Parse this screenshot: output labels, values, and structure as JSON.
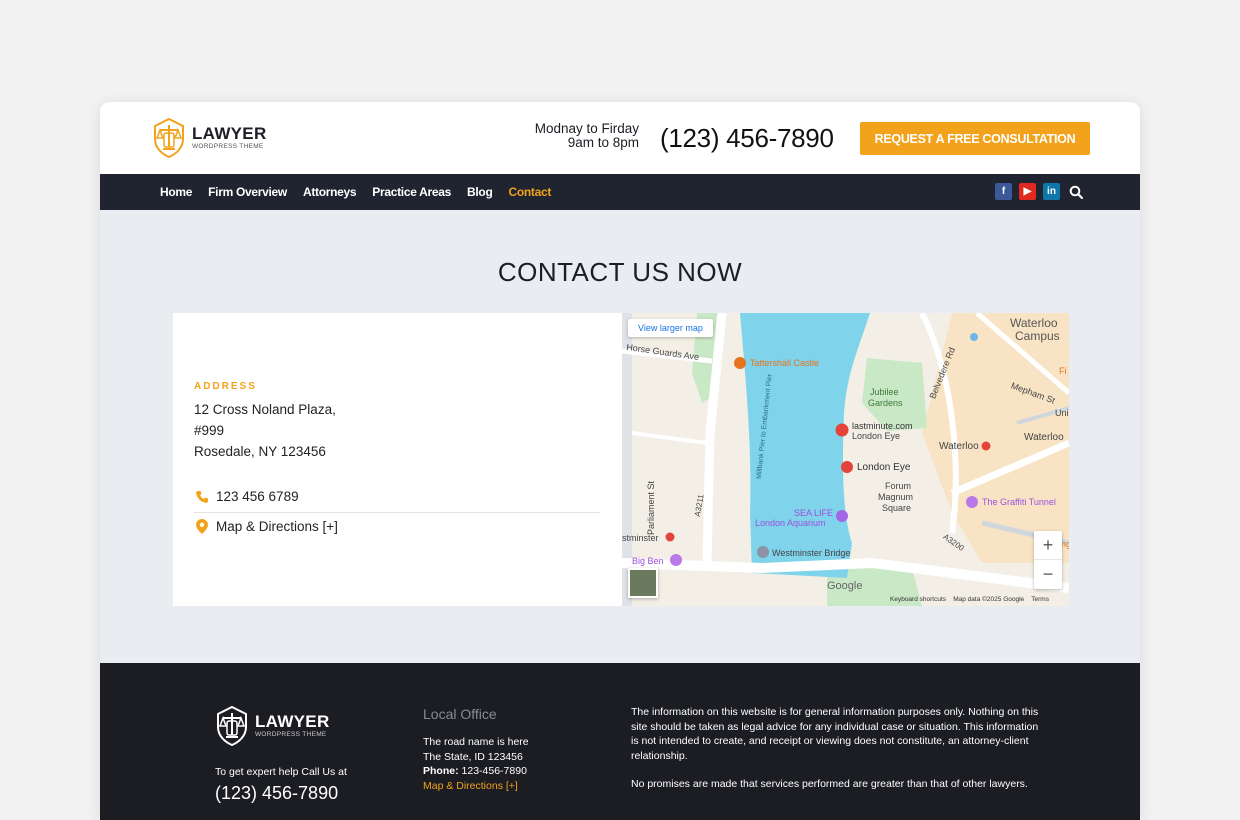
{
  "brand": {
    "name": "LAWYER",
    "tagline": "WORDPRESS THEME"
  },
  "header": {
    "hours_line1": "Modnay to Firday",
    "hours_line2": "9am to 8pm",
    "phone": "(123) 456-7890",
    "cta_label": "REQUEST A FREE CONSULTATION"
  },
  "nav": {
    "items": [
      {
        "label": "Home"
      },
      {
        "label": "Firm Overview"
      },
      {
        "label": "Attorneys"
      },
      {
        "label": "Practice Areas"
      },
      {
        "label": "Blog"
      },
      {
        "label": "Contact"
      }
    ],
    "active": "Contact",
    "social": {
      "facebook": "f",
      "youtube": "▶",
      "linkedin": "in"
    }
  },
  "contact": {
    "title": "CONTACT US NOW",
    "address_label": "ADDRESS",
    "address_line1": "12 Cross Noland Plaza,",
    "address_line2": "#999",
    "address_line3": "Rosedale, NY 123456",
    "phone": "123 456 6789",
    "map_link": "Map & Directions [+]"
  },
  "map": {
    "larger_map": "View larger map",
    "labels": {
      "waterloo_campus_1": "Waterloo",
      "waterloo_campus_2": "Campus",
      "horse_guards": "Horse Guards Ave",
      "tattershall": "Tattershall Castle",
      "jubilee_1": "Jubilee",
      "jubilee_2": "Gardens",
      "belvedere": "Belvedere Rd",
      "mepham": "Mepham St",
      "lastminute_1": "lastminute.com",
      "lastminute_2": "London Eye",
      "waterloo_station": "Waterloo",
      "waterloo_east": "Waterloo",
      "london_eye": "London Eye",
      "forum_1": "Forum",
      "forum_2": "Magnum",
      "forum_3": "Square",
      "graffiti": "The Graffiti Tunnel",
      "parliament": "Parliament St",
      "a3211": "A3211",
      "sea_life_1": "SEA LIFE",
      "sea_life_2": "London Aquarium",
      "westminster": "stminster",
      "westminster_bridge": "Westminster Bridge",
      "big_ben": "Big Ben",
      "a3200": "A3200",
      "embankment": "Millbank Pier to Embankment Pier",
      "google": "Google",
      "fi": "Fi",
      "uni": "Uni",
      "ng": "ng"
    },
    "zoom_in": "+",
    "zoom_out": "−",
    "attribution": "Keyboard shortcuts    Map data ©2025 Google    Terms",
    "colors": {
      "water": "#7fd3ea",
      "park": "#c9e8c5",
      "land": "#f3efe6",
      "sand": "#f8e4c4",
      "road": "#ffffff"
    }
  },
  "footer": {
    "call_label": "To get expert help Call Us at",
    "phone": "(123) 456-7890",
    "local_title": "Local Office",
    "local_line1": "The road name is here",
    "local_line2": "The  State, ID 123456",
    "phone_label": "Phone:",
    "phone_value": "123-456-7890",
    "map_link": "Map & Directions [+]",
    "disclaimer1": "The information on this website is for general information purposes only. Nothing on this site should be taken as legal advice for any individual case or situation. This information is not intended to create, and receipt or viewing does not constitute, an attorney-client relationship.",
    "disclaimer2": "No promises are made that services performed are greater than that of other lawyers."
  },
  "colors": {
    "accent": "#f2a21b",
    "nav_bg": "#1f2430",
    "footer_bg": "#1c1d23"
  }
}
